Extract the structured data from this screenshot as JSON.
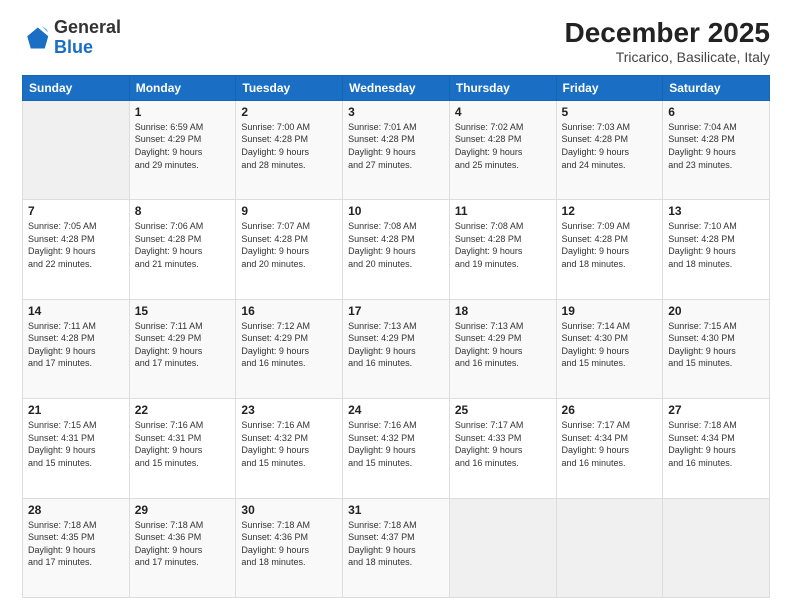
{
  "logo": {
    "general": "General",
    "blue": "Blue"
  },
  "title": "December 2025",
  "subtitle": "Tricarico, Basilicate, Italy",
  "header_days": [
    "Sunday",
    "Monday",
    "Tuesday",
    "Wednesday",
    "Thursday",
    "Friday",
    "Saturday"
  ],
  "weeks": [
    [
      {
        "day": "",
        "info": ""
      },
      {
        "day": "1",
        "info": "Sunrise: 6:59 AM\nSunset: 4:29 PM\nDaylight: 9 hours\nand 29 minutes."
      },
      {
        "day": "2",
        "info": "Sunrise: 7:00 AM\nSunset: 4:28 PM\nDaylight: 9 hours\nand 28 minutes."
      },
      {
        "day": "3",
        "info": "Sunrise: 7:01 AM\nSunset: 4:28 PM\nDaylight: 9 hours\nand 27 minutes."
      },
      {
        "day": "4",
        "info": "Sunrise: 7:02 AM\nSunset: 4:28 PM\nDaylight: 9 hours\nand 25 minutes."
      },
      {
        "day": "5",
        "info": "Sunrise: 7:03 AM\nSunset: 4:28 PM\nDaylight: 9 hours\nand 24 minutes."
      },
      {
        "day": "6",
        "info": "Sunrise: 7:04 AM\nSunset: 4:28 PM\nDaylight: 9 hours\nand 23 minutes."
      }
    ],
    [
      {
        "day": "7",
        "info": "Sunrise: 7:05 AM\nSunset: 4:28 PM\nDaylight: 9 hours\nand 22 minutes."
      },
      {
        "day": "8",
        "info": "Sunrise: 7:06 AM\nSunset: 4:28 PM\nDaylight: 9 hours\nand 21 minutes."
      },
      {
        "day": "9",
        "info": "Sunrise: 7:07 AM\nSunset: 4:28 PM\nDaylight: 9 hours\nand 20 minutes."
      },
      {
        "day": "10",
        "info": "Sunrise: 7:08 AM\nSunset: 4:28 PM\nDaylight: 9 hours\nand 20 minutes."
      },
      {
        "day": "11",
        "info": "Sunrise: 7:08 AM\nSunset: 4:28 PM\nDaylight: 9 hours\nand 19 minutes."
      },
      {
        "day": "12",
        "info": "Sunrise: 7:09 AM\nSunset: 4:28 PM\nDaylight: 9 hours\nand 18 minutes."
      },
      {
        "day": "13",
        "info": "Sunrise: 7:10 AM\nSunset: 4:28 PM\nDaylight: 9 hours\nand 18 minutes."
      }
    ],
    [
      {
        "day": "14",
        "info": "Sunrise: 7:11 AM\nSunset: 4:28 PM\nDaylight: 9 hours\nand 17 minutes."
      },
      {
        "day": "15",
        "info": "Sunrise: 7:11 AM\nSunset: 4:29 PM\nDaylight: 9 hours\nand 17 minutes."
      },
      {
        "day": "16",
        "info": "Sunrise: 7:12 AM\nSunset: 4:29 PM\nDaylight: 9 hours\nand 16 minutes."
      },
      {
        "day": "17",
        "info": "Sunrise: 7:13 AM\nSunset: 4:29 PM\nDaylight: 9 hours\nand 16 minutes."
      },
      {
        "day": "18",
        "info": "Sunrise: 7:13 AM\nSunset: 4:29 PM\nDaylight: 9 hours\nand 16 minutes."
      },
      {
        "day": "19",
        "info": "Sunrise: 7:14 AM\nSunset: 4:30 PM\nDaylight: 9 hours\nand 15 minutes."
      },
      {
        "day": "20",
        "info": "Sunrise: 7:15 AM\nSunset: 4:30 PM\nDaylight: 9 hours\nand 15 minutes."
      }
    ],
    [
      {
        "day": "21",
        "info": "Sunrise: 7:15 AM\nSunset: 4:31 PM\nDaylight: 9 hours\nand 15 minutes."
      },
      {
        "day": "22",
        "info": "Sunrise: 7:16 AM\nSunset: 4:31 PM\nDaylight: 9 hours\nand 15 minutes."
      },
      {
        "day": "23",
        "info": "Sunrise: 7:16 AM\nSunset: 4:32 PM\nDaylight: 9 hours\nand 15 minutes."
      },
      {
        "day": "24",
        "info": "Sunrise: 7:16 AM\nSunset: 4:32 PM\nDaylight: 9 hours\nand 15 minutes."
      },
      {
        "day": "25",
        "info": "Sunrise: 7:17 AM\nSunset: 4:33 PM\nDaylight: 9 hours\nand 16 minutes."
      },
      {
        "day": "26",
        "info": "Sunrise: 7:17 AM\nSunset: 4:34 PM\nDaylight: 9 hours\nand 16 minutes."
      },
      {
        "day": "27",
        "info": "Sunrise: 7:18 AM\nSunset: 4:34 PM\nDaylight: 9 hours\nand 16 minutes."
      }
    ],
    [
      {
        "day": "28",
        "info": "Sunrise: 7:18 AM\nSunset: 4:35 PM\nDaylight: 9 hours\nand 17 minutes."
      },
      {
        "day": "29",
        "info": "Sunrise: 7:18 AM\nSunset: 4:36 PM\nDaylight: 9 hours\nand 17 minutes."
      },
      {
        "day": "30",
        "info": "Sunrise: 7:18 AM\nSunset: 4:36 PM\nDaylight: 9 hours\nand 18 minutes."
      },
      {
        "day": "31",
        "info": "Sunrise: 7:18 AM\nSunset: 4:37 PM\nDaylight: 9 hours\nand 18 minutes."
      },
      {
        "day": "",
        "info": ""
      },
      {
        "day": "",
        "info": ""
      },
      {
        "day": "",
        "info": ""
      }
    ]
  ]
}
